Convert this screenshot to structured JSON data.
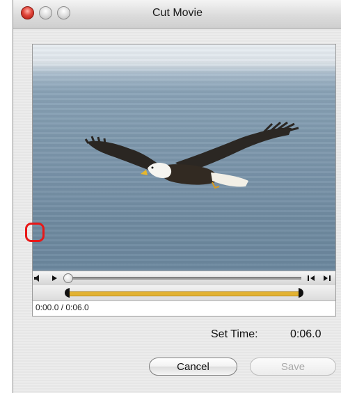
{
  "window": {
    "title": "Cut Movie"
  },
  "player": {
    "timecode": "0:00.0 / 0:06.0",
    "playhead_position": 0.0,
    "trim_start": 0.0,
    "trim_end": 1.0
  },
  "set_time": {
    "label": "Set Time:",
    "value": "0:06.0"
  },
  "buttons": {
    "cancel_label": "Cancel",
    "save_label": "Save",
    "save_enabled": false
  },
  "icons": {
    "close": "close-traffic-light",
    "minimize": "minimize-traffic-light",
    "zoom": "zoom-traffic-light",
    "volume": "volume-icon",
    "play": "play-icon",
    "step_back": "step-back-icon",
    "step_forward": "step-forward-icon"
  },
  "colors": {
    "trim_range": "#e2b232",
    "highlight": "#e81818",
    "close_button": "#e0453a"
  }
}
